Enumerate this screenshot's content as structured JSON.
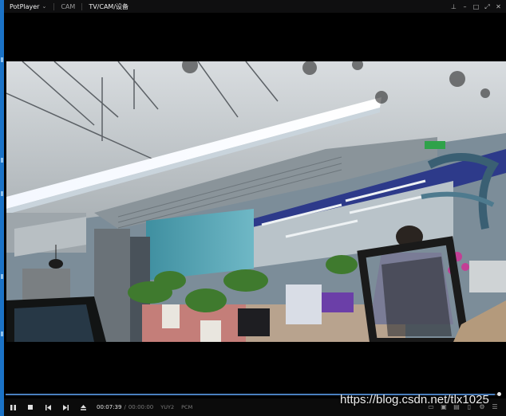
{
  "titlebar": {
    "app_name": "PotPlayer",
    "dropdown_glyph": "⌄",
    "tabs": [
      {
        "label": "CAM"
      },
      {
        "label": "TV/CAM/设备"
      }
    ],
    "controls": {
      "pin": "⊥",
      "minimize": "–",
      "maximize": "□",
      "fullscreen": "⤢",
      "close": "✕"
    }
  },
  "playback": {
    "current_time": "00:07:39",
    "separator": "/",
    "total_time": "00:00:00",
    "video_format": "YUY2",
    "audio_format": "PCM",
    "progress": 0.99
  },
  "right_icons": {
    "icon1": "▭",
    "icon2": "▣",
    "icon3": "▤",
    "icon4": "▯",
    "icon5": "⚙",
    "menu": "☰"
  },
  "watermark": "https://blog.csdn.net/tlx1025",
  "colors": {
    "titlebar_bg": "#0f0f10",
    "accent_left_strip": "#1b73c7",
    "seek_fill": "#4a7fbf"
  }
}
